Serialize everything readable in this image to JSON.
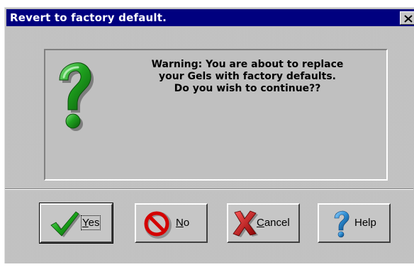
{
  "window": {
    "title": "Revert to factory default."
  },
  "message": {
    "line1": "Warning:  You are about to replace",
    "line2": "your Gels with factory defaults.",
    "line3": "Do you wish to continue??"
  },
  "icons": {
    "dialog_icon": "question-mark-icon",
    "yes": "checkmark-icon",
    "no": "prohibited-icon",
    "cancel": "x-icon",
    "help": "question-mark-icon"
  },
  "buttons": {
    "yes": {
      "first": "Y",
      "rest": "es"
    },
    "no": {
      "first": "N",
      "rest": "o"
    },
    "cancel": {
      "first": "C",
      "rest": "ancel"
    },
    "help": {
      "label": "Help"
    }
  },
  "colors": {
    "titlebar": "#00007f",
    "question_green": "#1ea01e",
    "check_green": "#1aa41a",
    "no_red": "#d40000",
    "cancel_red": "#cc0000",
    "help_blue": "#2a8ad0"
  }
}
